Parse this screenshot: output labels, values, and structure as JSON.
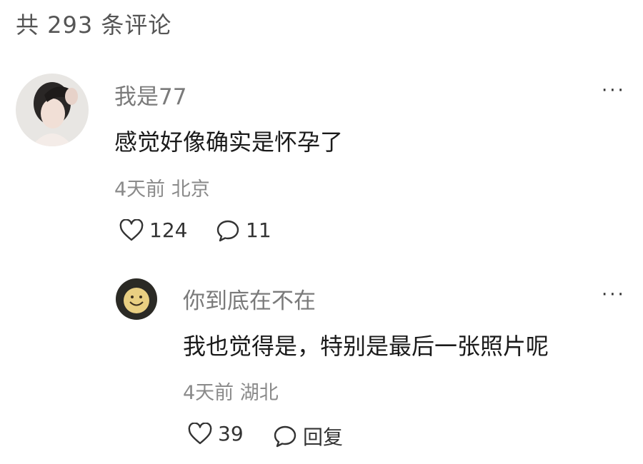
{
  "header": {
    "title": "共 293 条评论"
  },
  "comment": {
    "author": "我是77",
    "text": "感觉好像确实是怀孕了",
    "time_location": "4天前 北京",
    "likes": "124",
    "replies": "11",
    "more": "···"
  },
  "reply": {
    "author": "你到底在不在",
    "text": "我也觉得是，特别是最后一张照片呢",
    "time_location": "4天前 湖北",
    "likes": "39",
    "reply_label": "回复",
    "more": "···"
  },
  "icons": {
    "like": "heart-outline-icon",
    "comment": "speech-bubble-icon",
    "more": "more-dots-icon"
  }
}
